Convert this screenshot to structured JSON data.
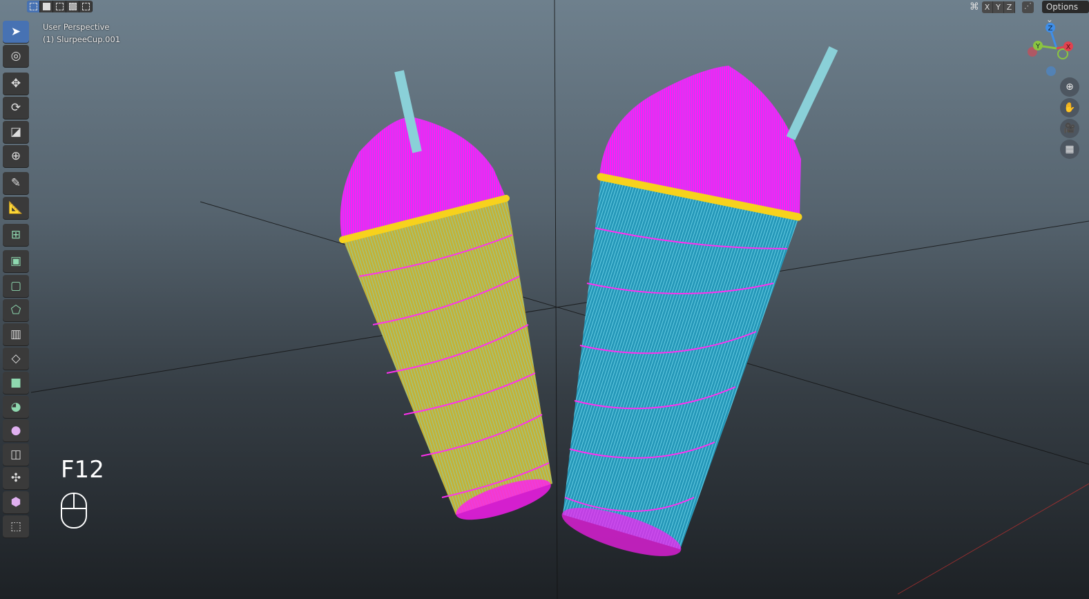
{
  "viewport": {
    "view_name": "User Perspective",
    "object_name": "(1) SlurpeeCup.001"
  },
  "header": {
    "select_modes": [
      "set",
      "extend",
      "subtract",
      "invert",
      "intersect"
    ],
    "axes": [
      "X",
      "Y",
      "Z"
    ],
    "options_label": "Options ⌄"
  },
  "gizmo": {
    "axes": [
      "X",
      "Y",
      "Z"
    ],
    "colors": {
      "x": "#e0424f",
      "y": "#8bc540",
      "z": "#3f8ee8"
    }
  },
  "nav_buttons": [
    "zoom-icon",
    "pan-hand-icon",
    "camera-icon",
    "perspective-grid-icon"
  ],
  "toolbar": [
    "select-box",
    "cursor",
    "move",
    "rotate",
    "scale",
    "transform",
    "annotate",
    "measure",
    "add-cube",
    "extrude",
    "inset",
    "bevel",
    "loop-cut",
    "knife",
    "poly-build",
    "spin",
    "smooth",
    "edge-slide",
    "shrink-fatten",
    "shear",
    "rip-region"
  ],
  "keystroke": {
    "key": "F12"
  },
  "colors": {
    "lid": "#ff22ff",
    "rim": "#f7d21c",
    "cup_left": "#c7b43a",
    "cup_right": "#2aa0c0",
    "wire": "#7ee8f0"
  }
}
